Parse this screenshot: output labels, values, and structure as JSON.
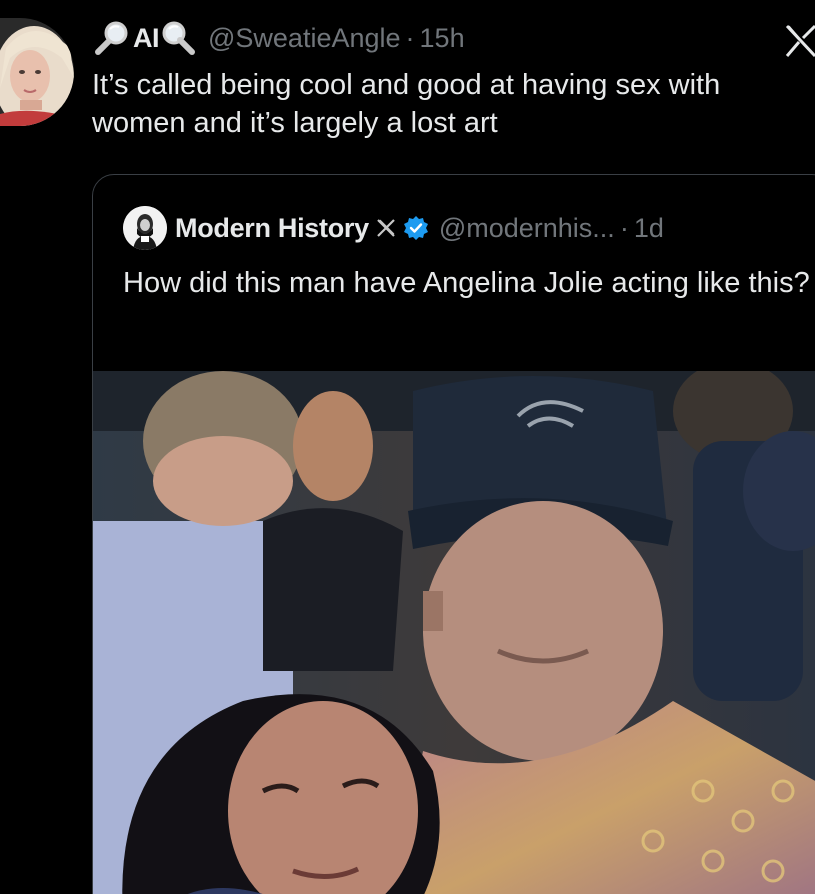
{
  "tweet": {
    "display_name": "AI",
    "handle": "@SweatieAngle",
    "separator": "·",
    "time": "15h",
    "text": "It’s called being cool and good at having sex with women and it’s largely a lost art",
    "left_emoji": "magnifying-glass-tilted-left-icon",
    "right_emoji": "magnifying-glass-tilted-right-icon"
  },
  "quote": {
    "display_name": "Modern History",
    "handle": "@modernhis...",
    "separator": "·",
    "time": "1d",
    "text": "How did this man have Angelina Jolie acting like this?",
    "verified": true
  },
  "colors": {
    "background": "#000000",
    "text_primary": "#e7e9ea",
    "text_secondary": "#71767b",
    "verified_blue": "#1d9bf0",
    "card_border": "#3a3f45"
  }
}
